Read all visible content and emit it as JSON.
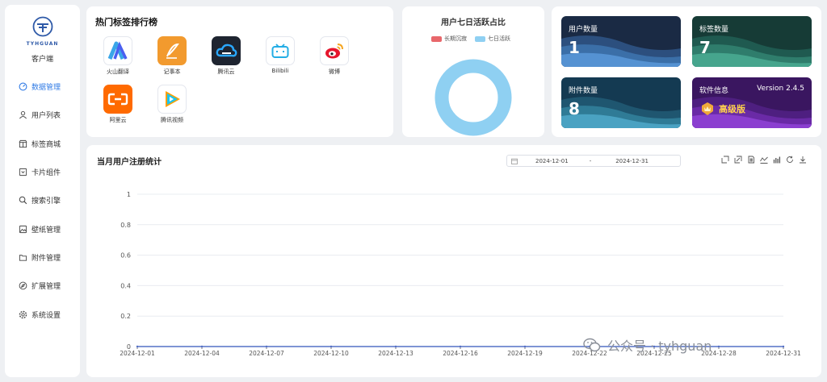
{
  "sidebar": {
    "logo_text": "TYHGUAN",
    "client_label": "客户端",
    "items": [
      {
        "label": "数据管理",
        "active": true
      },
      {
        "label": "用户列表",
        "active": false
      },
      {
        "label": "标签商城",
        "active": false
      },
      {
        "label": "卡片组件",
        "active": false
      },
      {
        "label": "搜索引擎",
        "active": false
      },
      {
        "label": "壁纸管理",
        "active": false
      },
      {
        "label": "附件管理",
        "active": false
      },
      {
        "label": "扩展管理",
        "active": false
      },
      {
        "label": "系统设置",
        "active": false
      }
    ]
  },
  "hot_tags": {
    "title": "热门标签排行榜",
    "apps": [
      {
        "label": "火山翻译",
        "icon": "volcano-translate-icon"
      },
      {
        "label": "记事本",
        "icon": "notepad-icon"
      },
      {
        "label": "腾讯云",
        "icon": "tencent-cloud-icon"
      },
      {
        "label": "Bilibili",
        "icon": "bilibili-icon"
      },
      {
        "label": "微博",
        "icon": "weibo-icon"
      },
      {
        "label": "阿里云",
        "icon": "aliyun-icon"
      },
      {
        "label": "腾讯视频",
        "icon": "tencent-video-icon"
      }
    ]
  },
  "activity": {
    "title": "用户七日活跃占比",
    "legend": [
      {
        "label": "长期沉寂",
        "color": "#e8676b"
      },
      {
        "label": "七日活跃",
        "color": "#8fd0f2"
      }
    ],
    "values": [
      0,
      1
    ]
  },
  "stats": {
    "users": {
      "title": "用户数量",
      "value": "1"
    },
    "tags": {
      "title": "标签数量",
      "value": "7"
    },
    "attachments": {
      "title": "附件数量",
      "value": "8"
    },
    "software": {
      "title": "软件信息",
      "version": "Version 2.4.5",
      "edition": "高级版"
    }
  },
  "chart_panel": {
    "title": "当月用户注册统计",
    "date_start": "2024-12-01",
    "date_sep": "-",
    "date_end": "2024-12-31",
    "tools": [
      "zoom-icon",
      "zoom-reset-icon",
      "data-view-icon",
      "line-icon",
      "bar-icon",
      "restore-icon",
      "download-icon"
    ]
  },
  "chart_data": {
    "type": "line",
    "x": [
      "2024-12-01",
      "2024-12-04",
      "2024-12-07",
      "2024-12-10",
      "2024-12-13",
      "2024-12-16",
      "2024-12-19",
      "2024-12-22",
      "2024-12-25",
      "2024-12-28",
      "2024-12-31"
    ],
    "values": [
      0,
      0,
      0,
      0,
      0,
      0,
      0,
      0,
      0,
      0,
      0
    ],
    "yticks": [
      "0",
      "0.2",
      "0.4",
      "0.6",
      "0.8",
      "1"
    ],
    "ylim": [
      0,
      1
    ],
    "grid": true
  },
  "watermark": {
    "text": "公众号 · tyhguan"
  }
}
